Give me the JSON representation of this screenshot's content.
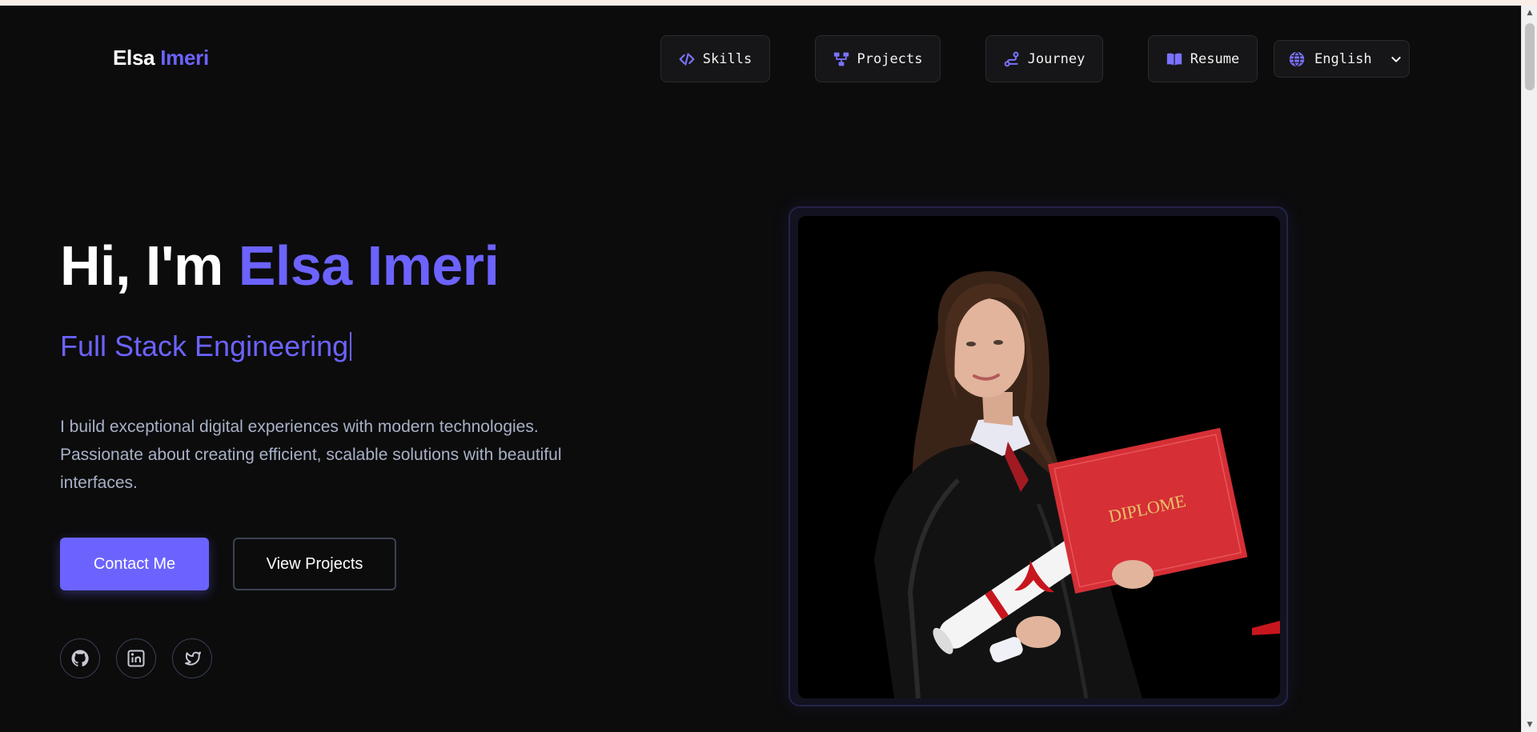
{
  "header": {
    "logo_first": "Elsa",
    "logo_last": "Imeri",
    "nav": [
      {
        "label": "Skills",
        "icon": "code-icon"
      },
      {
        "label": "Projects",
        "icon": "hierarchy-icon"
      },
      {
        "label": "Journey",
        "icon": "route-icon"
      },
      {
        "label": "Resume",
        "icon": "book-icon"
      }
    ],
    "language": {
      "label": "English",
      "icon": "globe-icon"
    }
  },
  "hero": {
    "greeting": "Hi, I'm",
    "name": "Elsa Imeri",
    "role": "Full Stack Engineering",
    "bio": "I build exceptional digital experiences with modern technologies. Passionate about creating efficient, scalable solutions with beautiful interfaces.",
    "primary_cta": "Contact Me",
    "secondary_cta": "View Projects",
    "socials": [
      "github-icon",
      "linkedin-icon",
      "twitter-icon"
    ]
  },
  "photo": {
    "diploma_text": "DIPLOME"
  },
  "colors": {
    "accent": "#6c63ff",
    "background": "#0c0c0d",
    "text_muted": "#a9b1c6"
  }
}
